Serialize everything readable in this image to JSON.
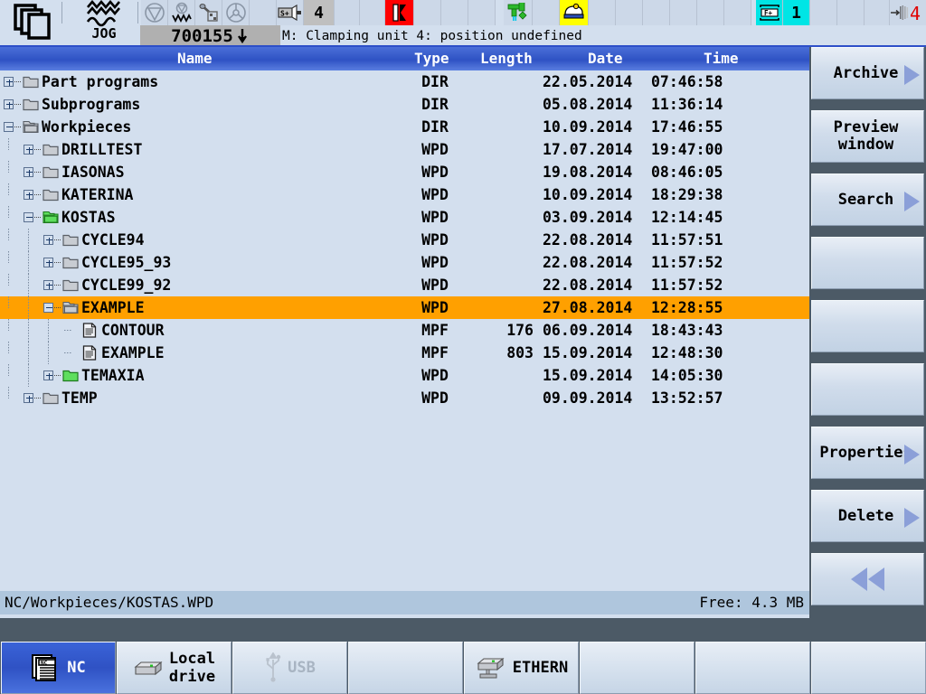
{
  "header": {
    "app_icon": "stacked-pages-icon",
    "mode": "JOG",
    "mode_icon": "jog-wave-icon",
    "status_icons": [
      {
        "name": "program-stop-icon"
      },
      {
        "name": "feed-override-icon"
      },
      {
        "name": "tool-measure-icon"
      },
      {
        "name": "handwheel-icon"
      },
      {
        "name": "empty-slot"
      },
      {
        "name": "spindle-direction-icon",
        "label": "S+"
      },
      {
        "name": "channel-number",
        "label": "4"
      },
      {
        "name": "empty-slot"
      },
      {
        "name": "empty-slot"
      },
      {
        "name": "empty-slot"
      },
      {
        "name": "clamping-alarm-icon"
      },
      {
        "name": "empty-slot"
      },
      {
        "name": "empty-slot"
      },
      {
        "name": "coolant-icon"
      },
      {
        "name": "empty-slot"
      },
      {
        "name": "lubrication-icon"
      },
      {
        "name": "empty-slot"
      },
      {
        "name": "empty-slot"
      },
      {
        "name": "empty-slot"
      },
      {
        "name": "empty-slot"
      },
      {
        "name": "empty-slot"
      },
      {
        "name": "empty-slot"
      },
      {
        "name": "feed-enable-icon",
        "label": "F+"
      },
      {
        "name": "axis-number",
        "label": "1"
      },
      {
        "name": "empty-slot"
      },
      {
        "name": "empty-slot"
      },
      {
        "name": "empty-slot"
      },
      {
        "name": "tool-spindle-icon",
        "label": "4"
      }
    ],
    "alarm_number": "700155",
    "alarm_text": "M: Clamping unit 4: position undefined"
  },
  "list": {
    "columns": [
      "Name",
      "Type",
      "Length",
      "Date",
      "Time"
    ],
    "rows": [
      {
        "name": "Part programs",
        "type": "DIR",
        "length": "",
        "date": "22.05.2014",
        "time": "07:46:58",
        "depth": 0,
        "icon": "folder-closed-icon",
        "expander": "plus",
        "selected": false
      },
      {
        "name": "Subprograms",
        "type": "DIR",
        "length": "",
        "date": "05.08.2014",
        "time": "11:36:14",
        "depth": 0,
        "icon": "folder-closed-icon",
        "expander": "plus",
        "selected": false
      },
      {
        "name": "Workpieces",
        "type": "DIR",
        "length": "",
        "date": "10.09.2014",
        "time": "17:46:55",
        "depth": 0,
        "icon": "folder-open-icon",
        "expander": "minus",
        "selected": false
      },
      {
        "name": "DRILLTEST",
        "type": "WPD",
        "length": "",
        "date": "17.07.2014",
        "time": "19:47:00",
        "depth": 1,
        "icon": "folder-closed-icon",
        "expander": "plus",
        "selected": false
      },
      {
        "name": "IASONAS",
        "type": "WPD",
        "length": "",
        "date": "19.08.2014",
        "time": "08:46:05",
        "depth": 1,
        "icon": "folder-closed-icon",
        "expander": "plus",
        "selected": false
      },
      {
        "name": "KATERINA",
        "type": "WPD",
        "length": "",
        "date": "10.09.2014",
        "time": "18:29:38",
        "depth": 1,
        "icon": "folder-closed-icon",
        "expander": "plus",
        "selected": false
      },
      {
        "name": "KOSTAS",
        "type": "WPD",
        "length": "",
        "date": "03.09.2014",
        "time": "12:14:45",
        "depth": 1,
        "icon": "folder-open-green-icon",
        "expander": "minus",
        "selected": false
      },
      {
        "name": "CYCLE94",
        "type": "WPD",
        "length": "",
        "date": "22.08.2014",
        "time": "11:57:51",
        "depth": 2,
        "icon": "folder-closed-icon",
        "expander": "plus",
        "selected": false
      },
      {
        "name": "CYCLE95_93",
        "type": "WPD",
        "length": "",
        "date": "22.08.2014",
        "time": "11:57:52",
        "depth": 2,
        "icon": "folder-closed-icon",
        "expander": "plus",
        "selected": false
      },
      {
        "name": "CYCLE99_92",
        "type": "WPD",
        "length": "",
        "date": "22.08.2014",
        "time": "11:57:52",
        "depth": 2,
        "icon": "folder-closed-icon",
        "expander": "plus",
        "selected": false
      },
      {
        "name": "EXAMPLE",
        "type": "WPD",
        "length": "",
        "date": "27.08.2014",
        "time": "12:28:55",
        "depth": 2,
        "icon": "folder-open-icon",
        "expander": "minus",
        "selected": true
      },
      {
        "name": "CONTOUR",
        "type": "MPF",
        "length": "176",
        "date": "06.09.2014",
        "time": "18:43:43",
        "depth": 3,
        "icon": "document-icon",
        "expander": "none",
        "selected": false
      },
      {
        "name": "EXAMPLE",
        "type": "MPF",
        "length": "803",
        "date": "15.09.2014",
        "time": "12:48:30",
        "depth": 3,
        "icon": "document-icon",
        "expander": "none",
        "selected": false
      },
      {
        "name": "TEMAXIA",
        "type": "WPD",
        "length": "",
        "date": "15.09.2014",
        "time": "14:05:30",
        "depth": 2,
        "icon": "folder-closed-green-icon",
        "expander": "plus",
        "selected": false
      },
      {
        "name": "TEMP",
        "type": "WPD",
        "length": "",
        "date": "09.09.2014",
        "time": "13:52:57",
        "depth": 1,
        "icon": "folder-closed-icon",
        "expander": "plus",
        "selected": false
      }
    ]
  },
  "statusbar": {
    "path": "NC/Workpieces/KOSTAS.WPD",
    "free": "Free: 4.3 MB"
  },
  "vertical_softkeys": [
    {
      "label": "Archive",
      "arrow": true,
      "slot": 0
    },
    {
      "label": "Preview\nwindow",
      "arrow": false,
      "slot": 1
    },
    {
      "label": "Search",
      "arrow": true,
      "slot": 2
    },
    {
      "label": "",
      "arrow": false,
      "slot": 3
    },
    {
      "label": "",
      "arrow": false,
      "slot": 4
    },
    {
      "label": "",
      "arrow": false,
      "slot": 5
    },
    {
      "label": "Properties",
      "arrow": true,
      "slot": 6
    },
    {
      "label": "Delete",
      "arrow": true,
      "slot": 7
    },
    {
      "label": "",
      "arrow": false,
      "slot": 8,
      "icon": "back-double-arrow-icon"
    }
  ],
  "horizontal_softkeys": [
    {
      "label": "NC",
      "icon": "nc-stack-icon",
      "active": true,
      "disabled": false
    },
    {
      "label": "Local\ndrive",
      "icon": "local-drive-icon",
      "active": false,
      "disabled": false
    },
    {
      "label": "USB",
      "icon": "usb-icon",
      "active": false,
      "disabled": true
    },
    {
      "label": "",
      "icon": "",
      "active": false,
      "disabled": false
    },
    {
      "label": "ETHERN",
      "icon": "ethernet-icon",
      "active": false,
      "disabled": false
    },
    {
      "label": "",
      "icon": "",
      "active": false,
      "disabled": false
    },
    {
      "label": "",
      "icon": "",
      "active": false,
      "disabled": false
    },
    {
      "label": "",
      "icon": "",
      "active": false,
      "disabled": false
    }
  ],
  "colors": {
    "selection": "#ffa000",
    "header_blue": "#2f52c4",
    "panel_bg": "#d3dfee",
    "chrome": "#4c5a66",
    "alarm_red": "#ff0000",
    "accent_cyan": "#00e5e5",
    "accent_yellow": "#ffff00",
    "accent_green": "#33cc33"
  }
}
